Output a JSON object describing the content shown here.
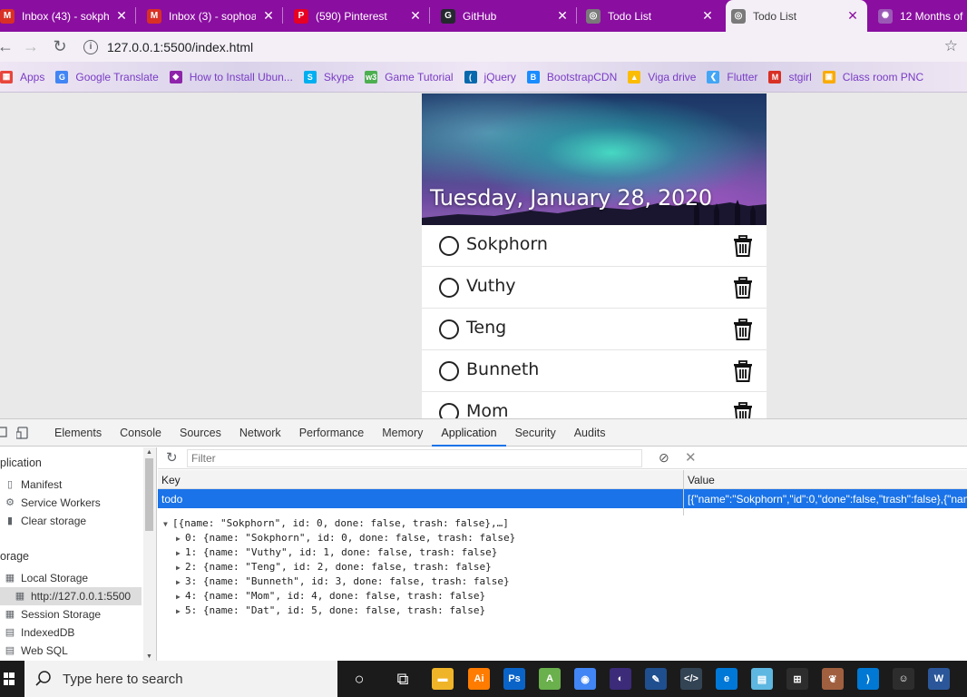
{
  "browser": {
    "tabs": [
      {
        "title": "Inbox (43) - sokph",
        "icon": "gmail-icon",
        "color": "#d93025",
        "glyph": "M",
        "active": false
      },
      {
        "title": "Inbox (3) - sophoa",
        "icon": "gmail-icon",
        "color": "#d93025",
        "glyph": "M",
        "active": false
      },
      {
        "title": "(590) Pinterest",
        "icon": "pinterest-icon",
        "color": "#e60023",
        "glyph": "P",
        "active": false
      },
      {
        "title": "GitHub",
        "icon": "github-icon",
        "color": "#24292e",
        "glyph": "G",
        "active": false
      },
      {
        "title": "Todo List",
        "icon": "globe-icon",
        "color": "#7a7a7a",
        "glyph": "◎",
        "active": false
      },
      {
        "title": "Todo List",
        "icon": "globe-icon",
        "color": "#7a7a7a",
        "glyph": "◎",
        "active": true
      },
      {
        "title": "12 Months of",
        "icon": "app-icon",
        "color": "#9b59b6",
        "glyph": "✺",
        "active": false
      }
    ],
    "url": "127.0.0.1:5500/index.html",
    "bookmarks": [
      {
        "label": "Apps",
        "icon": "apps-icon",
        "color": "#e8453c",
        "glyph": "▦"
      },
      {
        "label": "Google Translate",
        "icon": "translate-icon",
        "color": "#4285f4",
        "glyph": "G"
      },
      {
        "label": "How to Install Ubun...",
        "icon": "bookmark-icon",
        "color": "#8e24aa",
        "glyph": "◆"
      },
      {
        "label": "Skype",
        "icon": "skype-icon",
        "color": "#00aff0",
        "glyph": "S"
      },
      {
        "label": "Game Tutorial",
        "icon": "w3-icon",
        "color": "#4caf50",
        "glyph": "w3"
      },
      {
        "label": "jQuery",
        "icon": "jquery-icon",
        "color": "#0769ad",
        "glyph": "("
      },
      {
        "label": "BootstrapCDN",
        "icon": "bootstrap-icon",
        "color": "#1a8cff",
        "glyph": "B"
      },
      {
        "label": "Viga drive",
        "icon": "drive-icon",
        "color": "#fbbc04",
        "glyph": "▲"
      },
      {
        "label": "Flutter",
        "icon": "flutter-icon",
        "color": "#42a5f5",
        "glyph": "❮"
      },
      {
        "label": "stgirl",
        "icon": "gmail-icon",
        "color": "#d93025",
        "glyph": "M"
      },
      {
        "label": "Class room PNC",
        "icon": "classroom-icon",
        "color": "#f9ab00",
        "glyph": "▣"
      }
    ]
  },
  "todo": {
    "date": "Tuesday, January 28, 2020",
    "items": [
      "Sokphorn",
      "Vuthy",
      "Teng",
      "Bunneth",
      "Mom"
    ]
  },
  "devtools": {
    "tabs": [
      "Elements",
      "Console",
      "Sources",
      "Network",
      "Performance",
      "Memory",
      "Application",
      "Security",
      "Audits"
    ],
    "active_tab": "Application",
    "sidebar": {
      "application_header": "plication",
      "manifest": "Manifest",
      "service_workers": "Service Workers",
      "clear_storage": "Clear storage",
      "storage_header": "orage",
      "local_storage": "Local Storage",
      "local_storage_origin": "http://127.0.0.1:5500",
      "session_storage": "Session Storage",
      "indexeddb": "IndexedDB",
      "web_sql": "Web SQL"
    },
    "filter_placeholder": "Filter",
    "table": {
      "key_header": "Key",
      "value_header": "Value",
      "row_key": "todo",
      "row_value": "[{\"name\":\"Sokphorn\",\"id\":0,\"done\":false,\"trash\":false},{\"nam"
    },
    "tree": [
      "[{name: \"Sokphorn\", id: 0, done: false, trash: false},…]",
      "0: {name: \"Sokphorn\", id: 0, done: false, trash: false}",
      "1: {name: \"Vuthy\", id: 1, done: false, trash: false}",
      "2: {name: \"Teng\", id: 2, done: false, trash: false}",
      "3: {name: \"Bunneth\", id: 3, done: false, trash: false}",
      "4: {name: \"Mom\", id: 4, done: false, trash: false}",
      "5: {name: \"Dat\", id: 5, done: false, trash: false}"
    ]
  },
  "taskbar": {
    "search_placeholder": "Type here to search",
    "apps": [
      {
        "icon": "cortana-icon",
        "color": "#1b1b1b",
        "glyph": "○"
      },
      {
        "icon": "task-view-icon",
        "color": "#1b1b1b",
        "glyph": "⧉"
      },
      {
        "icon": "file-explorer-icon",
        "color": "#f0b429",
        "glyph": "▬"
      },
      {
        "icon": "illustrator-icon",
        "color": "#ff7c00",
        "glyph": "Ai"
      },
      {
        "icon": "photoshop-icon",
        "color": "#0a64c8",
        "glyph": "Ps"
      },
      {
        "icon": "android-studio-icon",
        "color": "#6ab04c",
        "glyph": "A"
      },
      {
        "icon": "chrome-icon",
        "color": "#4285f4",
        "glyph": "◉"
      },
      {
        "icon": "eclipse-icon",
        "color": "#3b2b78",
        "glyph": "◐"
      },
      {
        "icon": "app-icon",
        "color": "#1f4f8f",
        "glyph": "✎"
      },
      {
        "icon": "code-editor-icon",
        "color": "#345",
        "glyph": "</>"
      },
      {
        "icon": "edge-icon",
        "color": "#0078d7",
        "glyph": "e"
      },
      {
        "icon": "files-icon",
        "color": "#5db7e0",
        "glyph": "▤"
      },
      {
        "icon": "store-icon",
        "color": "#2d2d2d",
        "glyph": "⊞"
      },
      {
        "icon": "bird-icon",
        "color": "#a06040",
        "glyph": "❦"
      },
      {
        "icon": "vscode-icon",
        "color": "#0078d4",
        "glyph": "⟩"
      },
      {
        "icon": "emoji-icon",
        "color": "#2d2d2d",
        "glyph": "☺"
      },
      {
        "icon": "word-icon",
        "color": "#2b579a",
        "glyph": "W"
      }
    ]
  }
}
